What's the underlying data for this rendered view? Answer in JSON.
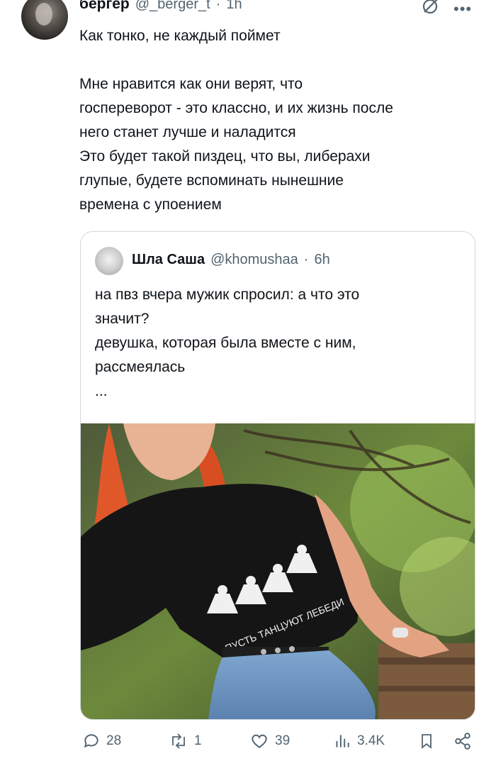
{
  "tweet": {
    "author_name": "бергер",
    "author_handle": "@_berger_t",
    "separator": "·",
    "time": "1h",
    "text": "Как тонко, не каждый поймет\n\nМне нравится как они верят, что\nгоспереворот - это классно, и их жизнь после\nнего станет лучше и наладится\nЭто будет такой пиздец, что вы, либерахи\nглупые, будете вспоминать нынешние\nвремена с упоением"
  },
  "quoted_tweet": {
    "author_name": "Шла Саша",
    "author_handle": "@khomushaa",
    "separator": "·",
    "time": "6h",
    "text": "на пвз вчера мужик спросил: а что это\nзначит?\nдевушка, которая была вместе с ним,\nрассмеялась\n...",
    "shirt_print": "ПУСТЬ ТАНЦУЮТ ЛЕБЕДИ"
  },
  "actions": {
    "replies": "28",
    "retweets": "1",
    "likes": "39",
    "views": "3.4K"
  },
  "icons": [
    "grok-icon",
    "more-icon",
    "reply-icon",
    "retweet-icon",
    "like-icon",
    "views-icon",
    "bookmark-icon",
    "share-icon"
  ],
  "colors": {
    "text": "#0f1419",
    "muted": "#536471",
    "border": "#cfd9de"
  }
}
